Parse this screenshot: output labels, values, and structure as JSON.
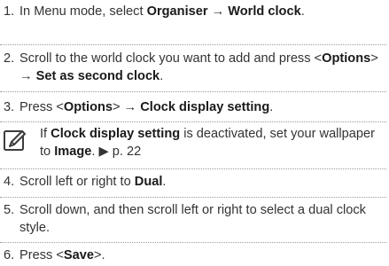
{
  "steps": [
    {
      "number": "1.",
      "text_1": "In Menu mode, select ",
      "bold_1": "Organiser",
      "arrow_1": " → ",
      "bold_2": "World clock",
      "text_2": "."
    },
    {
      "number": "2.",
      "text_1": "Scroll to the world clock you want to add and press <",
      "bold_1": "Options",
      "text_2": "> → ",
      "bold_2": "Set as second clock",
      "text_3": "."
    },
    {
      "number": "3.",
      "text_1": "Press <",
      "bold_1": "Options",
      "text_2": "> → ",
      "bold_2": "Clock display setting",
      "text_3": "."
    },
    {
      "number": "4.",
      "text_1": "Scroll left or right to ",
      "bold_1": "Dual",
      "text_2": "."
    },
    {
      "number": "5.",
      "text_1": "Scroll down, and then scroll left or right to select a dual clock style."
    },
    {
      "number": "6.",
      "text_1": "Press <",
      "bold_1": "Save",
      "text_2": ">."
    }
  ],
  "note": {
    "icon": "note-pencil-icon",
    "text_1": "If ",
    "bold_1": "Clock display setting",
    "text_2": " is deactivated, set your wallpaper to ",
    "bold_2": "Image",
    "text_3": ". ▶ p. 22"
  },
  "colors": {
    "text": "#333333",
    "divider": "#9a9a9a",
    "icon": "#3c3c3c"
  }
}
